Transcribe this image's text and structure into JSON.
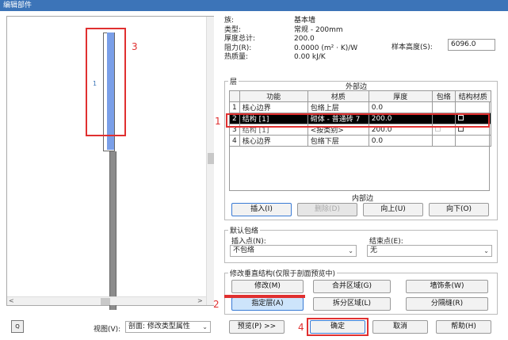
{
  "window": {
    "title": "编辑部件"
  },
  "props": {
    "family_key": "族:",
    "family_val": "基本墙",
    "type_key": "类型:",
    "type_val": "常规 - 200mm",
    "thickness_key": "厚度总计:",
    "thickness_val": "200.0",
    "resistance_key": "阻力(R):",
    "resistance_val": "0.0000 (m² · K)/W",
    "mass_key": "热质量:",
    "mass_val": "0.00 kJ/K",
    "sample_label": "样本高度(S):",
    "sample_value": "6096.0"
  },
  "layers": {
    "legend": "层",
    "exterior": "外部边",
    "interior": "内部边",
    "headers": [
      "",
      "功能",
      "材质",
      "厚度",
      "包络",
      "结构材质"
    ],
    "rows": [
      {
        "num": "1",
        "func": "核心边界",
        "mat": "包络上层",
        "thick": "0.0"
      },
      {
        "num": "2",
        "func": "结构 [1]",
        "mat": "砌体 - 普通砖 7",
        "thick": "200.0"
      },
      {
        "num": "3",
        "func": "结构 [1]",
        "mat": "<按类别>",
        "thick": "200.0"
      },
      {
        "num": "4",
        "func": "核心边界",
        "mat": "包络下层",
        "thick": "0.0"
      }
    ],
    "insert": "插入(I)",
    "delete": "删除(D)",
    "up": "向上(U)",
    "down": "向下(O)"
  },
  "wrap": {
    "legend": "默认包络",
    "insert_label": "插入点(N):",
    "insert_value": "不包络",
    "end_label": "结束点(E):",
    "end_value": "无"
  },
  "vertical": {
    "legend": "修改垂直结构(仅限于剖面预览中)",
    "modify": "修改(M)",
    "merge": "合并区域(G)",
    "sweep": "墙饰条(W)",
    "assign": "指定层(A)",
    "split": "拆分区域(L)",
    "reveal": "分隔缝(R)"
  },
  "footer": {
    "view_label": "视图(V):",
    "view_value": "剖面: 修改类型属性",
    "preview": "预览(P) >>",
    "ok": "确定",
    "cancel": "取消",
    "help": "帮助(H)",
    "zoom": "Q"
  },
  "preview_layer_mark": "1",
  "annotations": {
    "n1": "1",
    "n2": "2",
    "n3": "3",
    "n4": "4"
  },
  "colors": {
    "accent": "#e03030",
    "selection": "#000000",
    "wall_blue": "#7a9fe8"
  }
}
